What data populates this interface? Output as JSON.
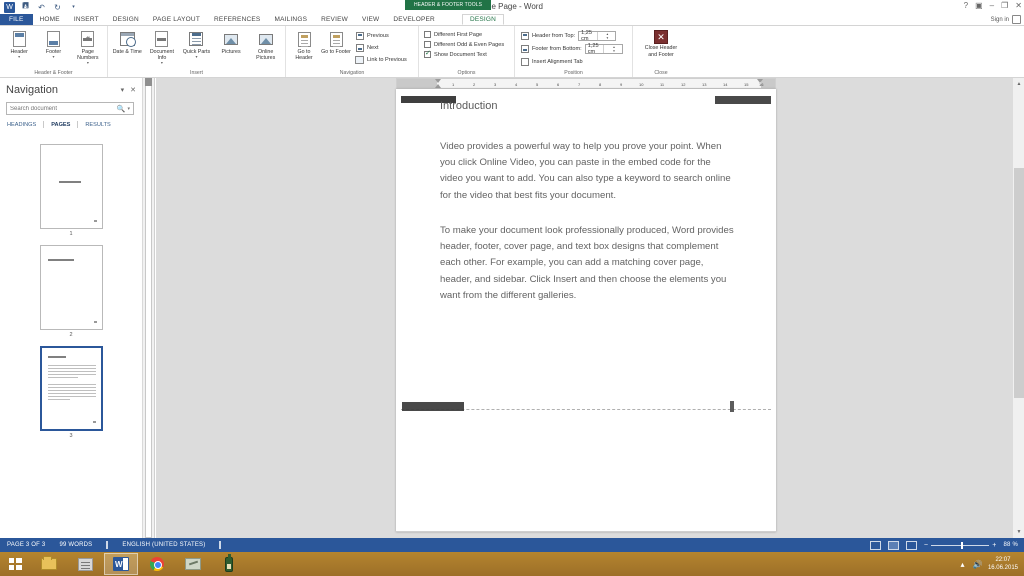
{
  "window": {
    "title": "Title Page - Word",
    "signin_label": "Sign in",
    "quick_access": [
      {
        "name": "word-icon",
        "glyph": "W"
      },
      {
        "name": "save-icon",
        "glyph": "὚B"
      },
      {
        "name": "undo-icon",
        "glyph": "↶"
      },
      {
        "name": "redo-icon",
        "glyph": "↻"
      },
      {
        "name": "customize-qat-icon",
        "glyph": "▾"
      }
    ],
    "controls": [
      {
        "name": "help-icon",
        "glyph": "?"
      },
      {
        "name": "ribbon-display-options-icon",
        "glyph": "▣"
      },
      {
        "name": "minimize-icon",
        "glyph": "–"
      },
      {
        "name": "restore-icon",
        "glyph": "❐"
      },
      {
        "name": "close-icon",
        "glyph": "✕"
      }
    ]
  },
  "contextual_banner": "HEADER & FOOTER TOOLS",
  "tabs": [
    {
      "label": "FILE",
      "kind": "file"
    },
    {
      "label": "HOME",
      "kind": "normal"
    },
    {
      "label": "INSERT",
      "kind": "normal"
    },
    {
      "label": "DESIGN",
      "kind": "normal"
    },
    {
      "label": "PAGE LAYOUT",
      "kind": "normal"
    },
    {
      "label": "REFERENCES",
      "kind": "normal"
    },
    {
      "label": "MAILINGS",
      "kind": "normal"
    },
    {
      "label": "REVIEW",
      "kind": "normal"
    },
    {
      "label": "VIEW",
      "kind": "normal"
    },
    {
      "label": "DEVELOPER",
      "kind": "normal"
    },
    {
      "label": "DESIGN",
      "kind": "active"
    }
  ],
  "ribbon": {
    "groups": [
      {
        "name": "header-footer",
        "label": "Header & Footer",
        "buttons": [
          {
            "label": "Header",
            "icon": "header-icon",
            "caret": true
          },
          {
            "label": "Footer",
            "icon": "footer-icon",
            "caret": true
          },
          {
            "label": "Page Numbers",
            "icon": "page-numbers-icon",
            "caret": true
          }
        ]
      },
      {
        "name": "insert",
        "label": "Insert",
        "buttons": [
          {
            "label": "Date & Time",
            "icon": "date-time-icon",
            "caret": false
          },
          {
            "label": "Document Info",
            "icon": "document-info-icon",
            "caret": true
          },
          {
            "label": "Quick Parts",
            "icon": "quick-parts-icon",
            "caret": true
          },
          {
            "label": "Pictures",
            "icon": "pictures-icon",
            "caret": false
          },
          {
            "label": "Online Pictures",
            "icon": "online-pictures-icon",
            "caret": false
          }
        ]
      },
      {
        "name": "navigation",
        "label": "Navigation",
        "buttons": [
          {
            "label": "Go to Header",
            "icon": "go-to-header-icon",
            "caret": false
          },
          {
            "label": "Go to Footer",
            "icon": "go-to-footer-icon",
            "caret": false
          }
        ],
        "small_commands": [
          {
            "label": "Previous",
            "icon": "previous-icon"
          },
          {
            "label": "Next",
            "icon": "next-icon"
          },
          {
            "label": "Link to Previous",
            "icon": "link-to-previous-icon"
          }
        ]
      },
      {
        "name": "options",
        "label": "Options",
        "checkboxes": [
          {
            "label": "Different First Page",
            "checked": false
          },
          {
            "label": "Different Odd & Even Pages",
            "checked": false
          },
          {
            "label": "Show Document Text",
            "checked": true
          }
        ]
      },
      {
        "name": "position",
        "label": "Position",
        "fields": [
          {
            "label": "Header from Top:",
            "value": "1,25 cm",
            "icon": "header-from-top-icon"
          },
          {
            "label": "Footer from Bottom:",
            "value": "1,25 cm",
            "icon": "footer-from-bottom-icon"
          }
        ],
        "commands": [
          {
            "label": "Insert Alignment Tab",
            "icon": "insert-alignment-tab-icon"
          }
        ]
      },
      {
        "name": "close",
        "label": "Close",
        "close_button": {
          "line1": "Close Header",
          "line2": "and Footer",
          "icon": "close-header-footer-icon",
          "glyph": "✕"
        }
      }
    ]
  },
  "navigation_pane": {
    "title": "Navigation",
    "controls": [
      {
        "name": "pane-options-icon",
        "glyph": "▾"
      },
      {
        "name": "close-pane-icon",
        "glyph": "✕"
      }
    ],
    "search": {
      "placeholder": "Search document",
      "value": "",
      "icon": "search-icon",
      "dropdown": "▾"
    },
    "tabs": [
      {
        "label": "HEADINGS",
        "active": false
      },
      {
        "label": "PAGES",
        "active": true
      },
      {
        "label": "RESULTS",
        "active": false
      }
    ],
    "thumbnails": [
      {
        "page_number": "1",
        "selected": false,
        "kind": "title"
      },
      {
        "page_number": "2",
        "selected": false,
        "kind": "heading-only"
      },
      {
        "page_number": "3",
        "selected": true,
        "kind": "text"
      }
    ]
  },
  "ruler": {
    "unit_marks": [
      "1",
      "2",
      "3",
      "4",
      "5",
      "6",
      "7",
      "8",
      "9",
      "10",
      "11",
      "12",
      "13",
      "14",
      "15",
      "16"
    ]
  },
  "document": {
    "heading": "Introduction",
    "paragraphs": [
      "Video provides a powerful way to help you prove your point. When you click Online Video, you can paste in the embed code for the video you want to add. You can also type a keyword to search online for the video that best fits your document.",
      "To make your document look professionally produced, Word provides header, footer, cover page, and text box designs that complement each other. For example, you can add a matching cover page, header, and sidebar. Click Insert and then choose the elements you want from the different galleries."
    ],
    "header_redactions": [
      "left-header-redaction",
      "right-header-redaction"
    ],
    "footer_redactions": [
      "footer-left-redaction",
      "footer-page-number-redaction"
    ]
  },
  "status_bar": {
    "page_info": "PAGE 3 OF 3",
    "word_count": "99 WORDS",
    "proofing_icon": "proofing-errors-icon",
    "language": "ENGLISH (UNITED STATES)",
    "macro_icon": "macro-recording-icon",
    "views": [
      {
        "name": "read-mode-view",
        "active": false
      },
      {
        "name": "print-layout-view",
        "active": true
      },
      {
        "name": "web-layout-view",
        "active": false
      }
    ],
    "zoom_out": "−",
    "zoom_in": "+",
    "zoom_level": "88 %"
  },
  "taskbar": {
    "start": {
      "name": "start-button"
    },
    "apps": [
      {
        "name": "file-explorer-icon",
        "active": false
      },
      {
        "name": "store-icon",
        "active": false
      },
      {
        "name": "word-taskbar-icon",
        "active": true,
        "glyph": "W"
      },
      {
        "name": "chrome-icon",
        "active": false
      },
      {
        "name": "paint-icon",
        "active": false
      },
      {
        "name": "bottle-app-icon",
        "active": false
      }
    ],
    "tray": [
      {
        "name": "show-hidden-icons",
        "glyph": "▴"
      },
      {
        "name": "volume-icon",
        "glyph": "ὐA"
      }
    ],
    "clock": {
      "time": "22:07",
      "date": "16.06.2015"
    }
  }
}
